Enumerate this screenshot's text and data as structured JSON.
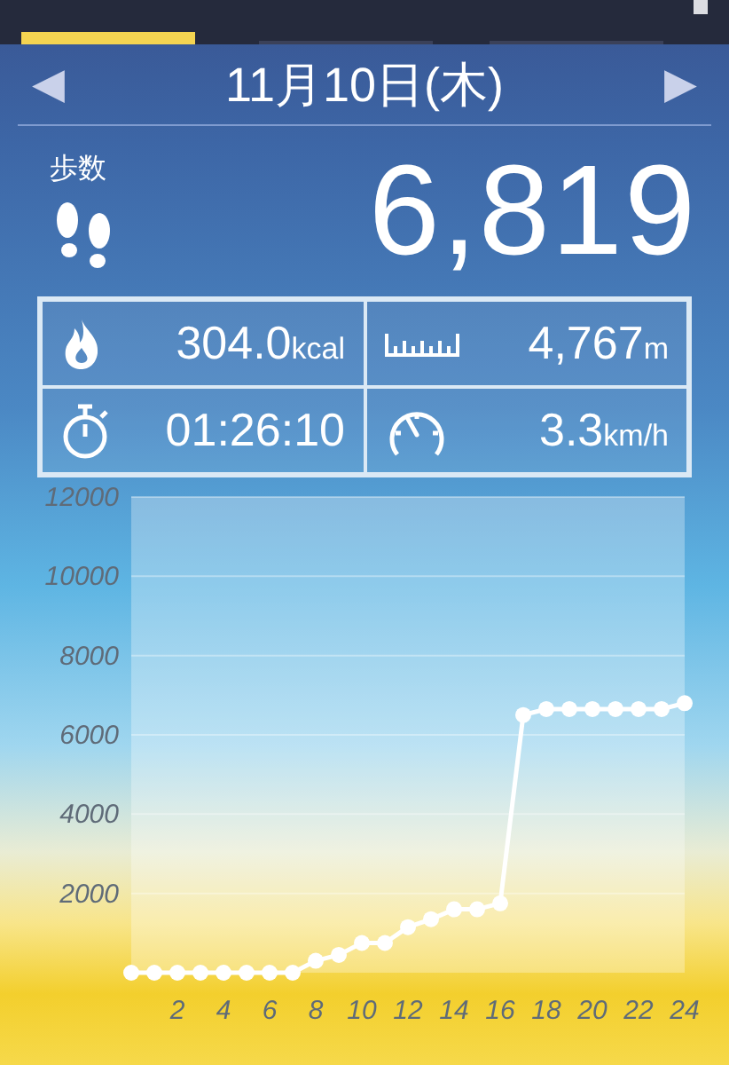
{
  "tabs": [
    {
      "selected": true
    },
    {
      "selected": false
    },
    {
      "selected": false
    }
  ],
  "date_nav": {
    "prev": "◀",
    "date": "11月10日(木)",
    "next": "▶"
  },
  "steps": {
    "label": "歩数",
    "value": "6,819"
  },
  "stats": [
    {
      "kind": "calories",
      "value": "304.0",
      "unit": "kcal"
    },
    {
      "kind": "distance",
      "value": "4,767",
      "unit": "m"
    },
    {
      "kind": "time",
      "value": "01:26:10"
    },
    {
      "kind": "speed",
      "value": "3.3",
      "unit": "km/h"
    }
  ],
  "chart": {
    "chart_data": {
      "type": "line",
      "x": [
        0,
        1,
        2,
        3,
        4,
        5,
        6,
        7,
        8,
        9,
        10,
        11,
        12,
        13,
        14,
        15,
        16,
        17,
        18,
        19,
        20,
        21,
        22,
        23,
        24
      ],
      "series": [
        {
          "color": "#ffffff",
          "marker": true,
          "values": [
            0,
            0,
            0,
            0,
            0,
            0,
            0,
            0,
            300,
            450,
            750,
            750,
            1150,
            1350,
            1600,
            1600,
            1750,
            6500,
            6650,
            6650,
            6650,
            6650,
            6650,
            6650,
            6800
          ]
        }
      ],
      "grid": true,
      "xlim": [
        0,
        24
      ],
      "ylim": [
        0,
        12000
      ],
      "xticks": [
        2,
        4,
        6,
        8,
        10,
        12,
        14,
        16,
        18,
        20,
        22,
        24
      ],
      "yticks": [
        2000,
        4000,
        6000,
        8000,
        10000,
        12000
      ]
    }
  }
}
